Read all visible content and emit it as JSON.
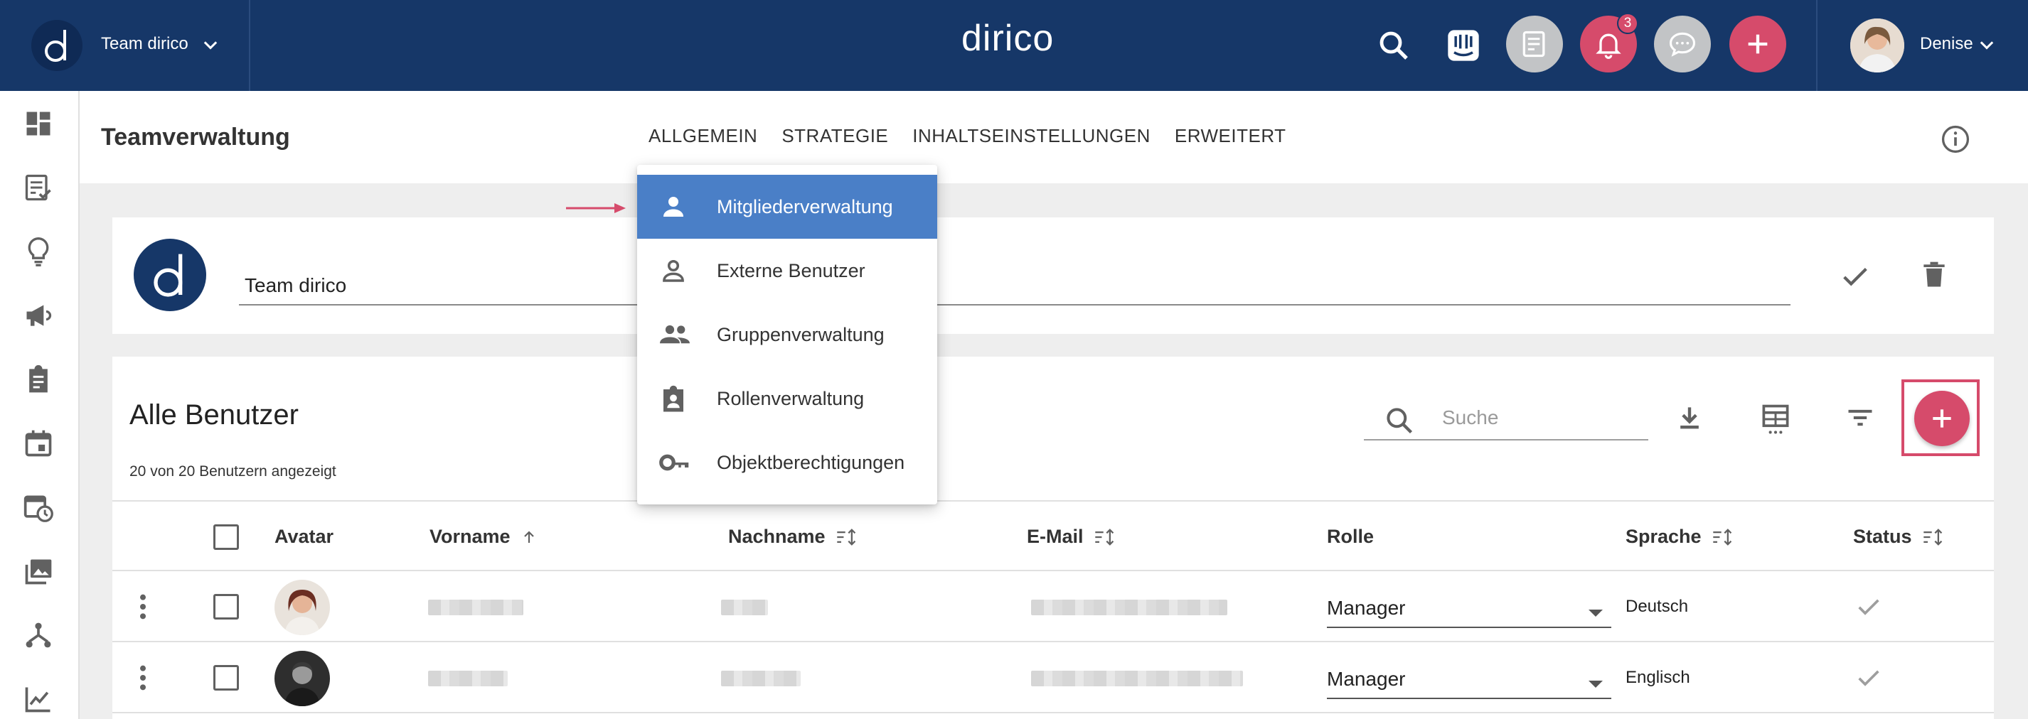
{
  "topbar": {
    "team_name": "Team dirico",
    "brand": "dirico",
    "notification_count": "3",
    "user_name": "Denise"
  },
  "header": {
    "title": "Teamverwaltung",
    "tabs": [
      "ALLGEMEIN",
      "STRATEGIE",
      "INHALTSEINSTELLUNGEN",
      "ERWEITERT"
    ]
  },
  "team_card": {
    "name_value": "Team dirico"
  },
  "users": {
    "title": "Alle Benutzer",
    "count_text": "20 von 20 Benutzern angezeigt",
    "search_placeholder": "Suche",
    "columns": {
      "avatar": "Avatar",
      "first_name": "Vorname",
      "last_name": "Nachname",
      "email": "E-Mail",
      "role": "Rolle",
      "language": "Sprache",
      "status": "Status"
    },
    "rows": [
      {
        "role": "Manager",
        "language": "Deutsch"
      },
      {
        "role": "Manager",
        "language": "Englisch"
      }
    ]
  },
  "dropdown": {
    "items": [
      {
        "label": "Mitgliederverwaltung",
        "icon": "person-icon"
      },
      {
        "label": "Externe Benutzer",
        "icon": "person-outline-icon"
      },
      {
        "label": "Gruppenverwaltung",
        "icon": "group-icon"
      },
      {
        "label": "Rollenverwaltung",
        "icon": "assignment-ind-icon"
      },
      {
        "label": "Objektberechtigungen",
        "icon": "key-icon"
      }
    ]
  },
  "colors": {
    "topbar": "#163768",
    "accent": "#d64b6b",
    "menu_active": "#4a7fc7"
  }
}
